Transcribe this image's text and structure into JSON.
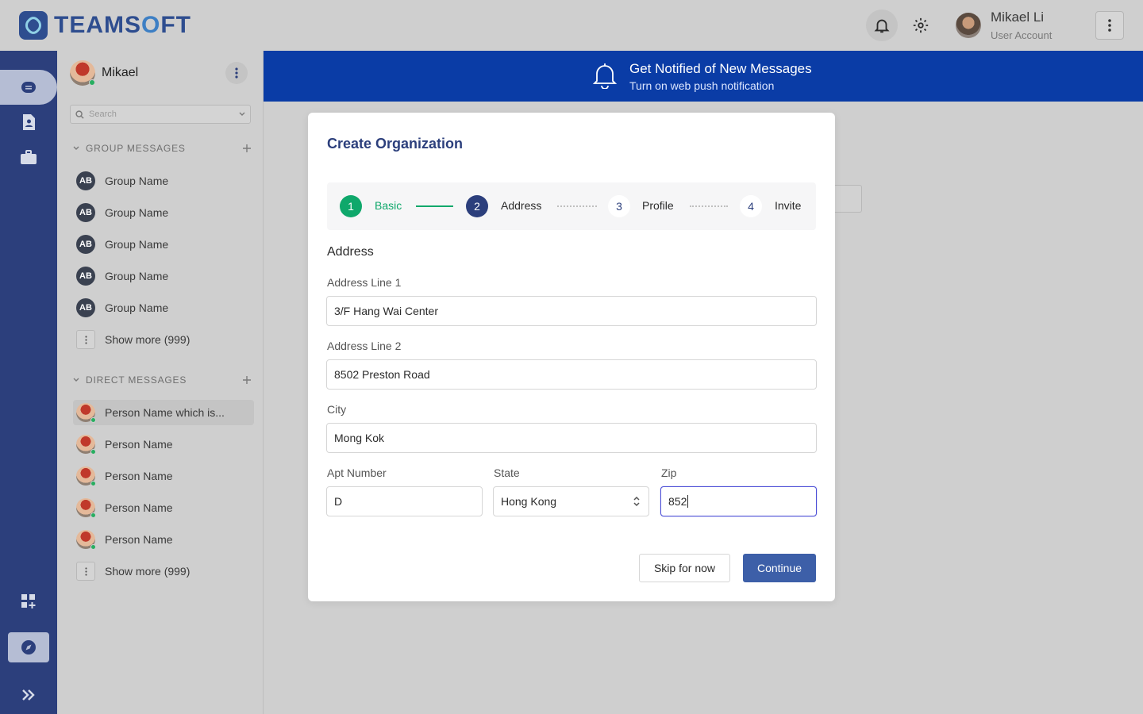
{
  "app": {
    "logo_text_a": "TEAMS",
    "logo_text_b": "O",
    "logo_text_c": "FT"
  },
  "header": {
    "user_name": "Mikael Li",
    "user_role": "User Account"
  },
  "sidebar": {
    "user_name": "Mikael",
    "search_placeholder": "Search",
    "group_section_label": "GROUP MESSAGES",
    "groups": [
      {
        "initials": "AB",
        "label": "Group Name"
      },
      {
        "initials": "AB",
        "label": "Group Name"
      },
      {
        "initials": "AB",
        "label": "Group Name"
      },
      {
        "initials": "AB",
        "label": "Group Name"
      },
      {
        "initials": "AB",
        "label": "Group Name"
      }
    ],
    "groups_show_more": "Show more (999)",
    "direct_section_label": "DIRECT MESSAGES",
    "directs": [
      {
        "label": "Person Name which is..."
      },
      {
        "label": "Person Name"
      },
      {
        "label": "Person Name"
      },
      {
        "label": "Person Name"
      },
      {
        "label": "Person Name"
      }
    ],
    "directs_show_more": "Show more (999)"
  },
  "banner": {
    "title": "Get Notified of New Messages",
    "subtitle": "Turn on web push notification"
  },
  "modal": {
    "title": "Create Organization",
    "steps": [
      {
        "number": "1",
        "label": "Basic",
        "state": "done"
      },
      {
        "number": "2",
        "label": "Address",
        "state": "active"
      },
      {
        "number": "3",
        "label": "Profile",
        "state": "pending"
      },
      {
        "number": "4",
        "label": "Invite",
        "state": "pending"
      }
    ],
    "section_title": "Address",
    "address_line1": {
      "label": "Address Line 1",
      "value": "3/F Hang Wai Center"
    },
    "address_line2": {
      "label": "Address Line 2",
      "value": "8502 Preston Road"
    },
    "city": {
      "label": "City",
      "value": "Mong Kok"
    },
    "apt": {
      "label": "Apt Number",
      "value": "D"
    },
    "state": {
      "label": "State",
      "value": "Hong Kong"
    },
    "zip": {
      "label": "Zip",
      "value": "852"
    },
    "skip_label": "Skip for now",
    "continue_label": "Continue"
  },
  "colors": {
    "brand": "#2c3f7c",
    "banner": "#0a3ca6",
    "step_done": "#0fa86b",
    "step_active": "#2c3f7c",
    "primary_button": "#3d5fa8"
  }
}
